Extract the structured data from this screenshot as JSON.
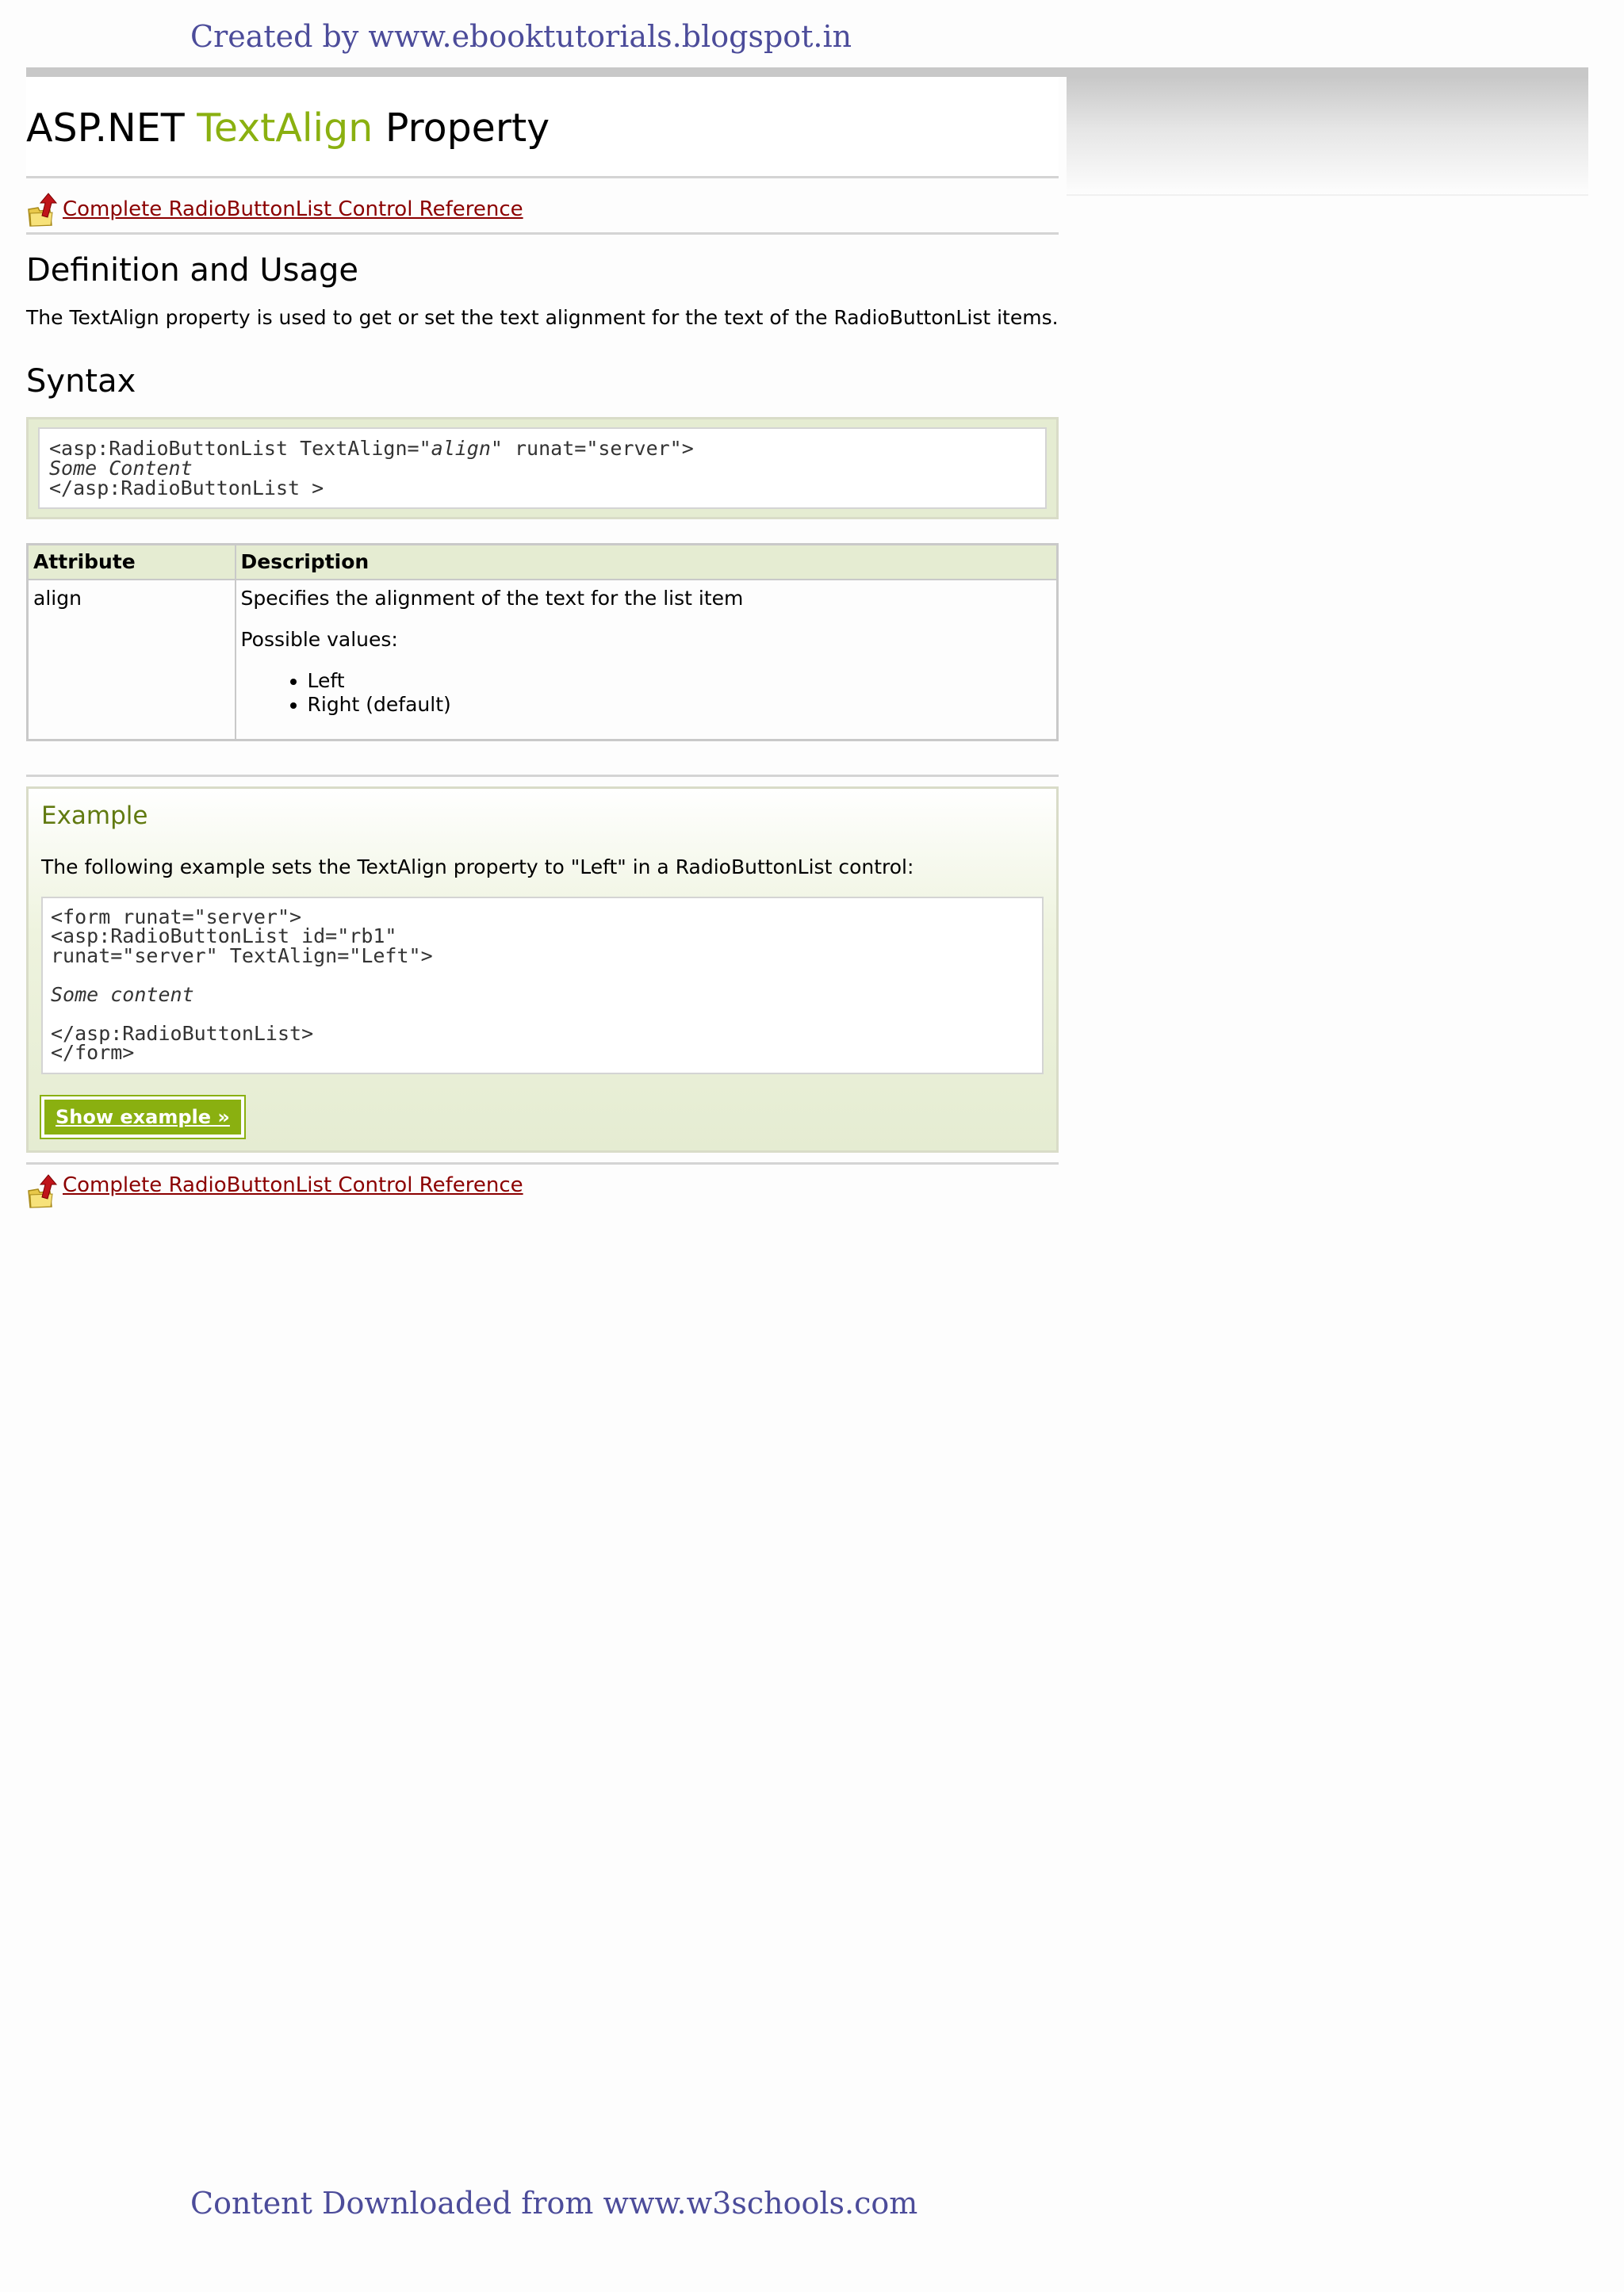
{
  "page": {
    "header_credit": "Created by www.ebooktutorials.blogspot.in",
    "footer_credit": "Content Downloaded from www.w3schools.com"
  },
  "title": {
    "part1": "ASP.NET ",
    "accent": "TextAlign",
    "part2": " Property"
  },
  "reference_link": "Complete RadioButtonList Control Reference",
  "definition": {
    "heading": "Definition and Usage",
    "text": "The TextAlign property is used to get or set the text alignment for the text of the RadioButtonList items."
  },
  "syntax": {
    "heading": "Syntax",
    "line1_a": "<asp:RadioButtonList TextAlign=\"",
    "line1_italic": "align",
    "line1_b": "\" runat=\"server\">",
    "line2": "Some Content",
    "line3": "</asp:RadioButtonList >"
  },
  "table": {
    "headers": [
      "Attribute",
      "Description"
    ],
    "attribute": "align",
    "description": "Specifies the alignment of the text for the list item",
    "possible_values_label": "Possible values:",
    "values": [
      "Left",
      "Right (default)"
    ]
  },
  "example": {
    "title": "Example",
    "intro": "The following example sets the TextAlign property to \"Left\" in a RadioButtonList control:",
    "code_line1": "<form runat=\"server\">",
    "code_line2": "<asp:RadioButtonList id=\"rb1\"",
    "code_line3": "runat=\"server\" TextAlign=\"Left\">",
    "code_line4": "Some content",
    "code_line5": "</asp:RadioButtonList>",
    "code_line6": "</form>",
    "button": "Show example »"
  },
  "colors": {
    "accent": "#8ab010",
    "link": "#8b0000",
    "credit": "#4c4c9a",
    "box_bg": "#e5ecd2"
  },
  "icons": [
    "folder-up-arrow-icon"
  ]
}
